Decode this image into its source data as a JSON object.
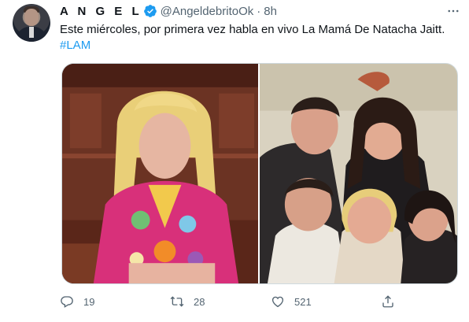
{
  "tweet": {
    "display_name": "A N G E L",
    "handle": "@AngeldebritoOk",
    "separator": "·",
    "time": "8h",
    "text": "Este miércoles, por primera vez habla en vivo La Mamá De Natacha Jaitt.",
    "hashtag": "#LAM",
    "accent_color": "#1d9bf0"
  },
  "actions": {
    "reply_count": "19",
    "retweet_count": "28",
    "like_count": "521"
  },
  "icons": {
    "verified": "verified-badge-icon",
    "more": "more-icon",
    "reply": "reply-icon",
    "retweet": "retweet-icon",
    "like": "heart-icon",
    "share": "share-icon"
  }
}
